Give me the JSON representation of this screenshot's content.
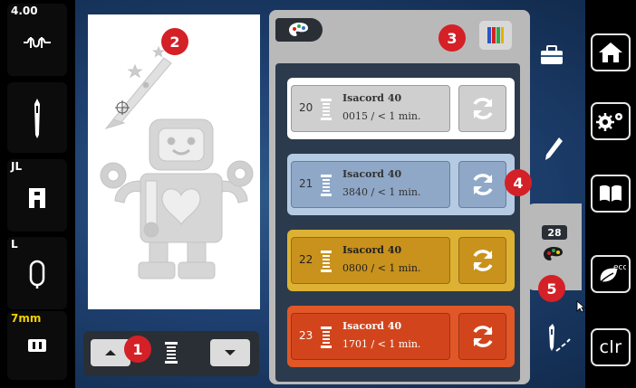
{
  "left_bar": {
    "tension": "4.00",
    "presser_foot": "JL",
    "hoop": "L",
    "stitch_width": "7mm"
  },
  "color_panel": {
    "colors": [
      {
        "number": "20",
        "name": "Isacord 40",
        "info": "0015 / < 1 min.",
        "color": "#cfcfcf",
        "row_bg": "#ffffff",
        "btn_bg": "#cfcfcf",
        "text_color": "#333333"
      },
      {
        "number": "21",
        "name": "Isacord 40",
        "info": "3840 / < 1 min.",
        "color": "#8fa8c8",
        "row_bg": "#b5cbe4",
        "btn_bg": "#8fa8c8",
        "text_color": "#333333"
      },
      {
        "number": "22",
        "name": "Isacord 40",
        "info": "0800 / < 1 min.",
        "color": "#c9921c",
        "row_bg": "#ddb234",
        "btn_bg": "#c9921c",
        "text_color": "#1f1f1f"
      },
      {
        "number": "23",
        "name": "Isacord 40",
        "info": "1701 / < 1 min.",
        "color": "#d2451c",
        "row_bg": "#e15727",
        "btn_bg": "#d2451c",
        "text_color": "#ffffff"
      }
    ]
  },
  "color_count": "28",
  "right_bar": {
    "clr_label": "clr",
    "eco_label": "eco"
  },
  "callouts": [
    "1",
    "2",
    "3",
    "4",
    "5"
  ]
}
